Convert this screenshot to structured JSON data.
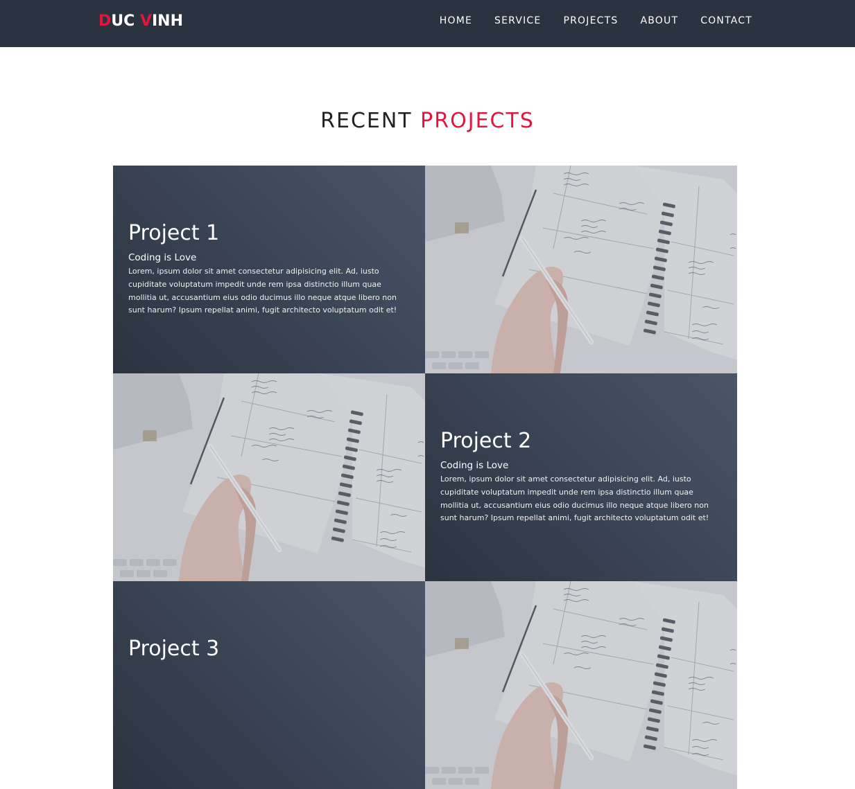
{
  "brand": {
    "part1_accent": "D",
    "part1_rest": "UC ",
    "part2_accent": "V",
    "part2_rest": "INH"
  },
  "nav": {
    "items": [
      {
        "label": "HOME"
      },
      {
        "label": "SERVICE"
      },
      {
        "label": "PROJECTS"
      },
      {
        "label": "ABOUT"
      },
      {
        "label": "CONTACT"
      }
    ]
  },
  "section": {
    "title_plain": "RECENT ",
    "title_accent": "PROJECTS"
  },
  "projects": [
    {
      "title": "Project 1",
      "subtitle": "Coding is Love",
      "description": "Lorem, ipsum dolor sit amet consectetur adipisicing elit. Ad, iusto cupiditate voluptatum impedit unde rem ipsa distinctio illum quae mollitia ut, accusantium eius odio ducimus illo neque atque libero non sunt harum? Ipsum repellat animi, fugit architecto voluptatum odit et!"
    },
    {
      "title": "Project 2",
      "subtitle": "Coding is Love",
      "description": "Lorem, ipsum dolor sit amet consectetur adipisicing elit. Ad, iusto cupiditate voluptatum impedit unde rem ipsa distinctio illum quae mollitia ut, accusantium eius odio ducimus illo neque atque libero non sunt harum? Ipsum repellat animi, fugit architecto voluptatum odit et!"
    },
    {
      "title": "Project 3",
      "subtitle": "",
      "description": ""
    }
  ],
  "colors": {
    "navbar": "#2c3340",
    "accent": "#e0163f",
    "card": "#3b4657"
  }
}
